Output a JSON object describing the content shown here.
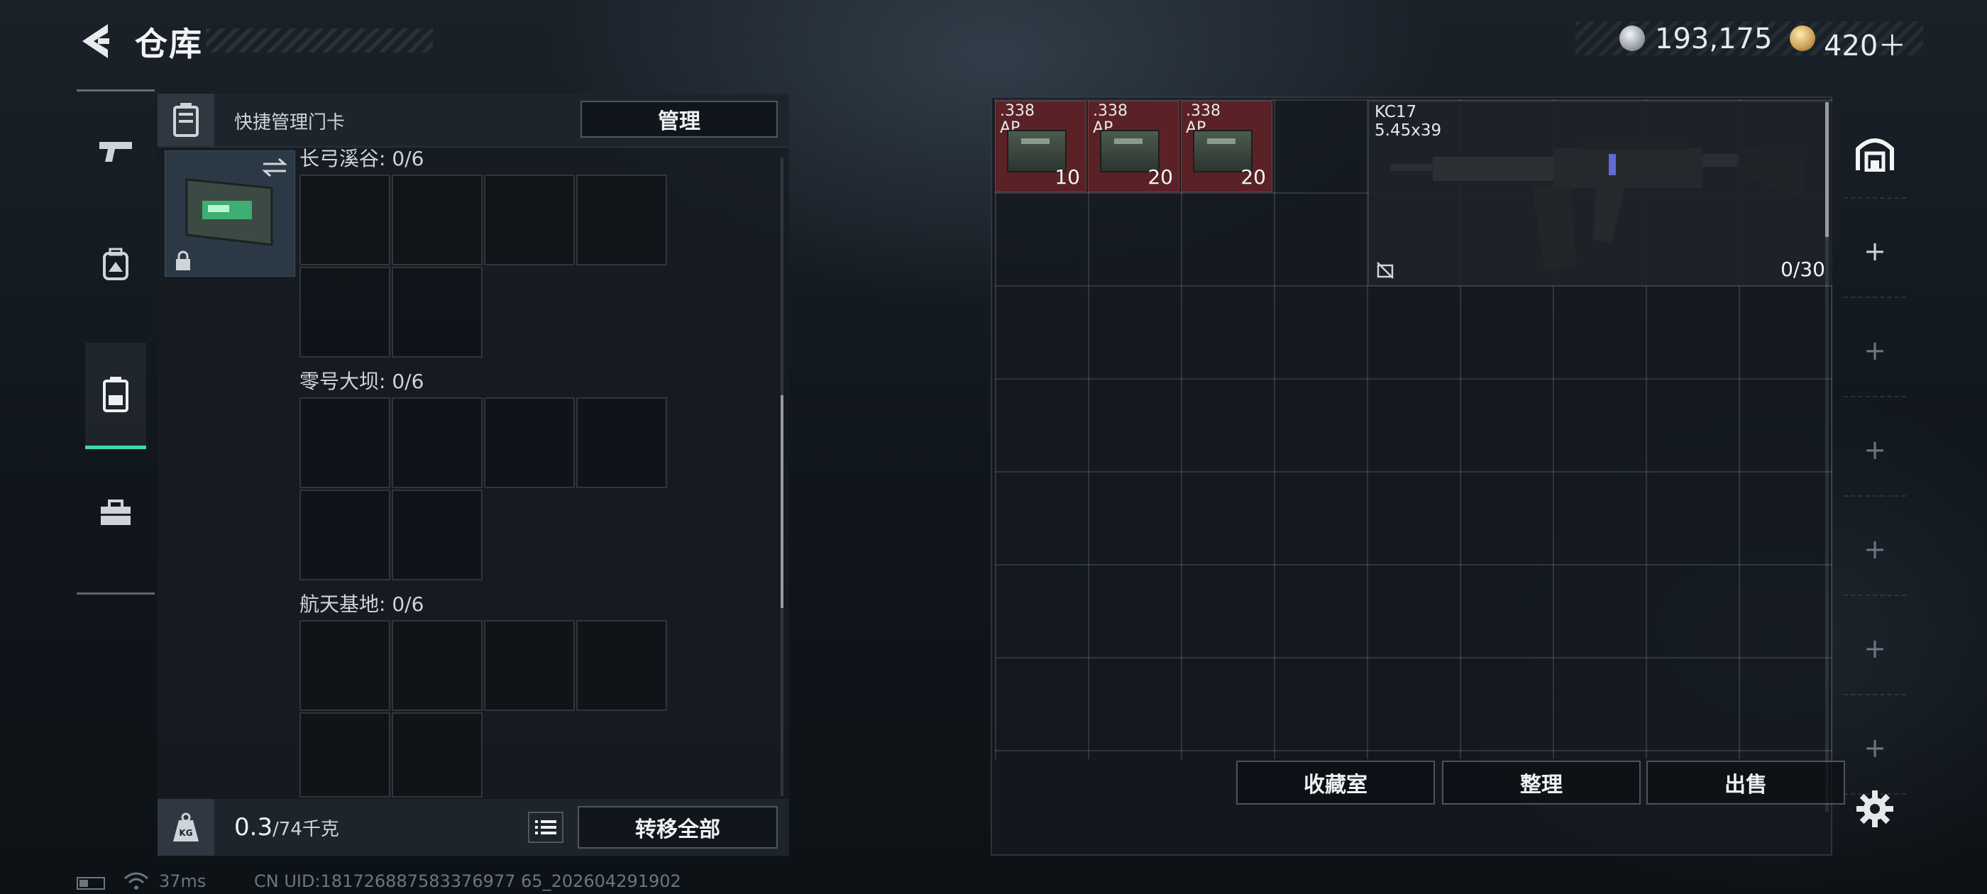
{
  "header": {
    "title": "仓库",
    "currency": [
      {
        "icon": "silver-coin-icon",
        "value": "193,175"
      },
      {
        "icon": "gold-coin-icon",
        "value": "420＋"
      }
    ]
  },
  "left_nav": {
    "items": [
      {
        "icon": "pistol-icon",
        "active": false
      },
      {
        "icon": "backpack-icon",
        "active": false
      },
      {
        "icon": "keycard-case-icon",
        "active": true
      },
      {
        "icon": "toolbox-icon",
        "active": false
      }
    ],
    "accent": "#3fd9b0"
  },
  "left_panel": {
    "header_label": "快捷管理门卡",
    "manage_button": "管理",
    "grids": [
      {
        "label": "长弓溪谷: 0/6"
      },
      {
        "label": "零号大坝: 0/6"
      },
      {
        "label": "航天基地: 0/6"
      }
    ],
    "footer": {
      "weight_icon": "KG",
      "weight_current": "0.3",
      "weight_max": "/74千克",
      "transfer_all_button": "转移全部"
    }
  },
  "stash": {
    "items": [
      {
        "caliber": ".338",
        "type": "AP",
        "count": "10"
      },
      {
        "caliber": ".338",
        "type": "AP",
        "count": "20"
      },
      {
        "caliber": ".338",
        "type": "AP",
        "count": "20"
      }
    ],
    "weapon": {
      "name": "KC17",
      "caliber": "5.45x39",
      "ammo": "0/30"
    },
    "buttons": {
      "collection": "收藏室",
      "sort": "整理",
      "sell": "出售"
    },
    "ammo_highlight_color": "#5a2126"
  },
  "right_tabs": [
    "stash-home-icon",
    "+",
    "+",
    "+",
    "+",
    "+",
    "+"
  ],
  "status_bar": {
    "ping": "37ms",
    "uid": "CN UID:181726887583376977 65_202604291902"
  }
}
